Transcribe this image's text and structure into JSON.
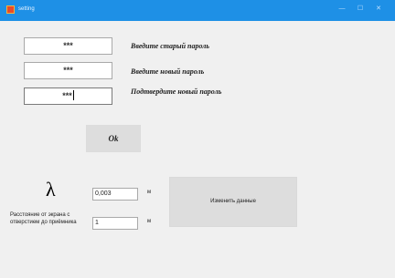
{
  "window": {
    "title": "setting",
    "minimize_symbol": "—",
    "maximize_symbol": "☐",
    "close_symbol": "✕"
  },
  "password": {
    "old_value": "***",
    "new_value": "***",
    "confirm_value": "***",
    "old_label": "Введите старый пароль",
    "new_label": "Введите новый пароль",
    "confirm_label": "Подтвердите новый пароль",
    "ok_label": "Ok"
  },
  "params": {
    "lambda_symbol": "λ",
    "lambda_value": "0,003",
    "lambda_unit": "м",
    "distance_label": "Расстояние от экрана с отверстием до приёмника",
    "distance_value": "1",
    "distance_unit": "м",
    "change_label": "Изменить данные"
  }
}
